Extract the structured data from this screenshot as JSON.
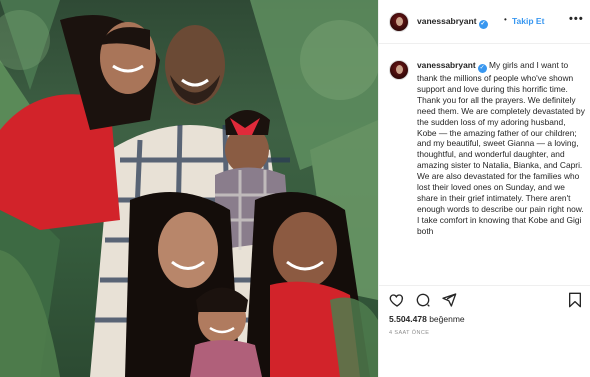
{
  "post": {
    "username": "vanessabryant",
    "verified_icon": "verified-badge-icon",
    "separator": "•",
    "follow_label": "Takip Et",
    "more_icon": "more-options-icon",
    "caption_user": "vanessabryant",
    "caption_text": "My girls and I want to thank the millions of people who've shown support and love during this horrific time. Thank you for all the prayers. We definitely need them. We are completely devastated by the sudden loss of my adoring husband, Kobe — the amazing father of our children; and my beautiful, sweet Gianna — a loving, thoughtful, and wonderful daughter, and amazing sister to Natalia, Bianka, and Capri. We are also devastated for the families who lost their loved ones on Sunday, and we share in their grief intimately. There aren't enough words to describe our pain right now. I take comfort in knowing that Kobe and Gigi both",
    "likes_count": "5.504.478",
    "likes_label": "beğenme",
    "timestamp": "4 SAAT ÖNCE"
  },
  "icons": {
    "like": "heart-icon",
    "comment": "comment-icon",
    "share": "share-icon",
    "save": "bookmark-icon"
  },
  "colors": {
    "link_blue": "#3897f0",
    "text": "#262626",
    "muted": "#8e8e8e",
    "border": "#efefef"
  }
}
